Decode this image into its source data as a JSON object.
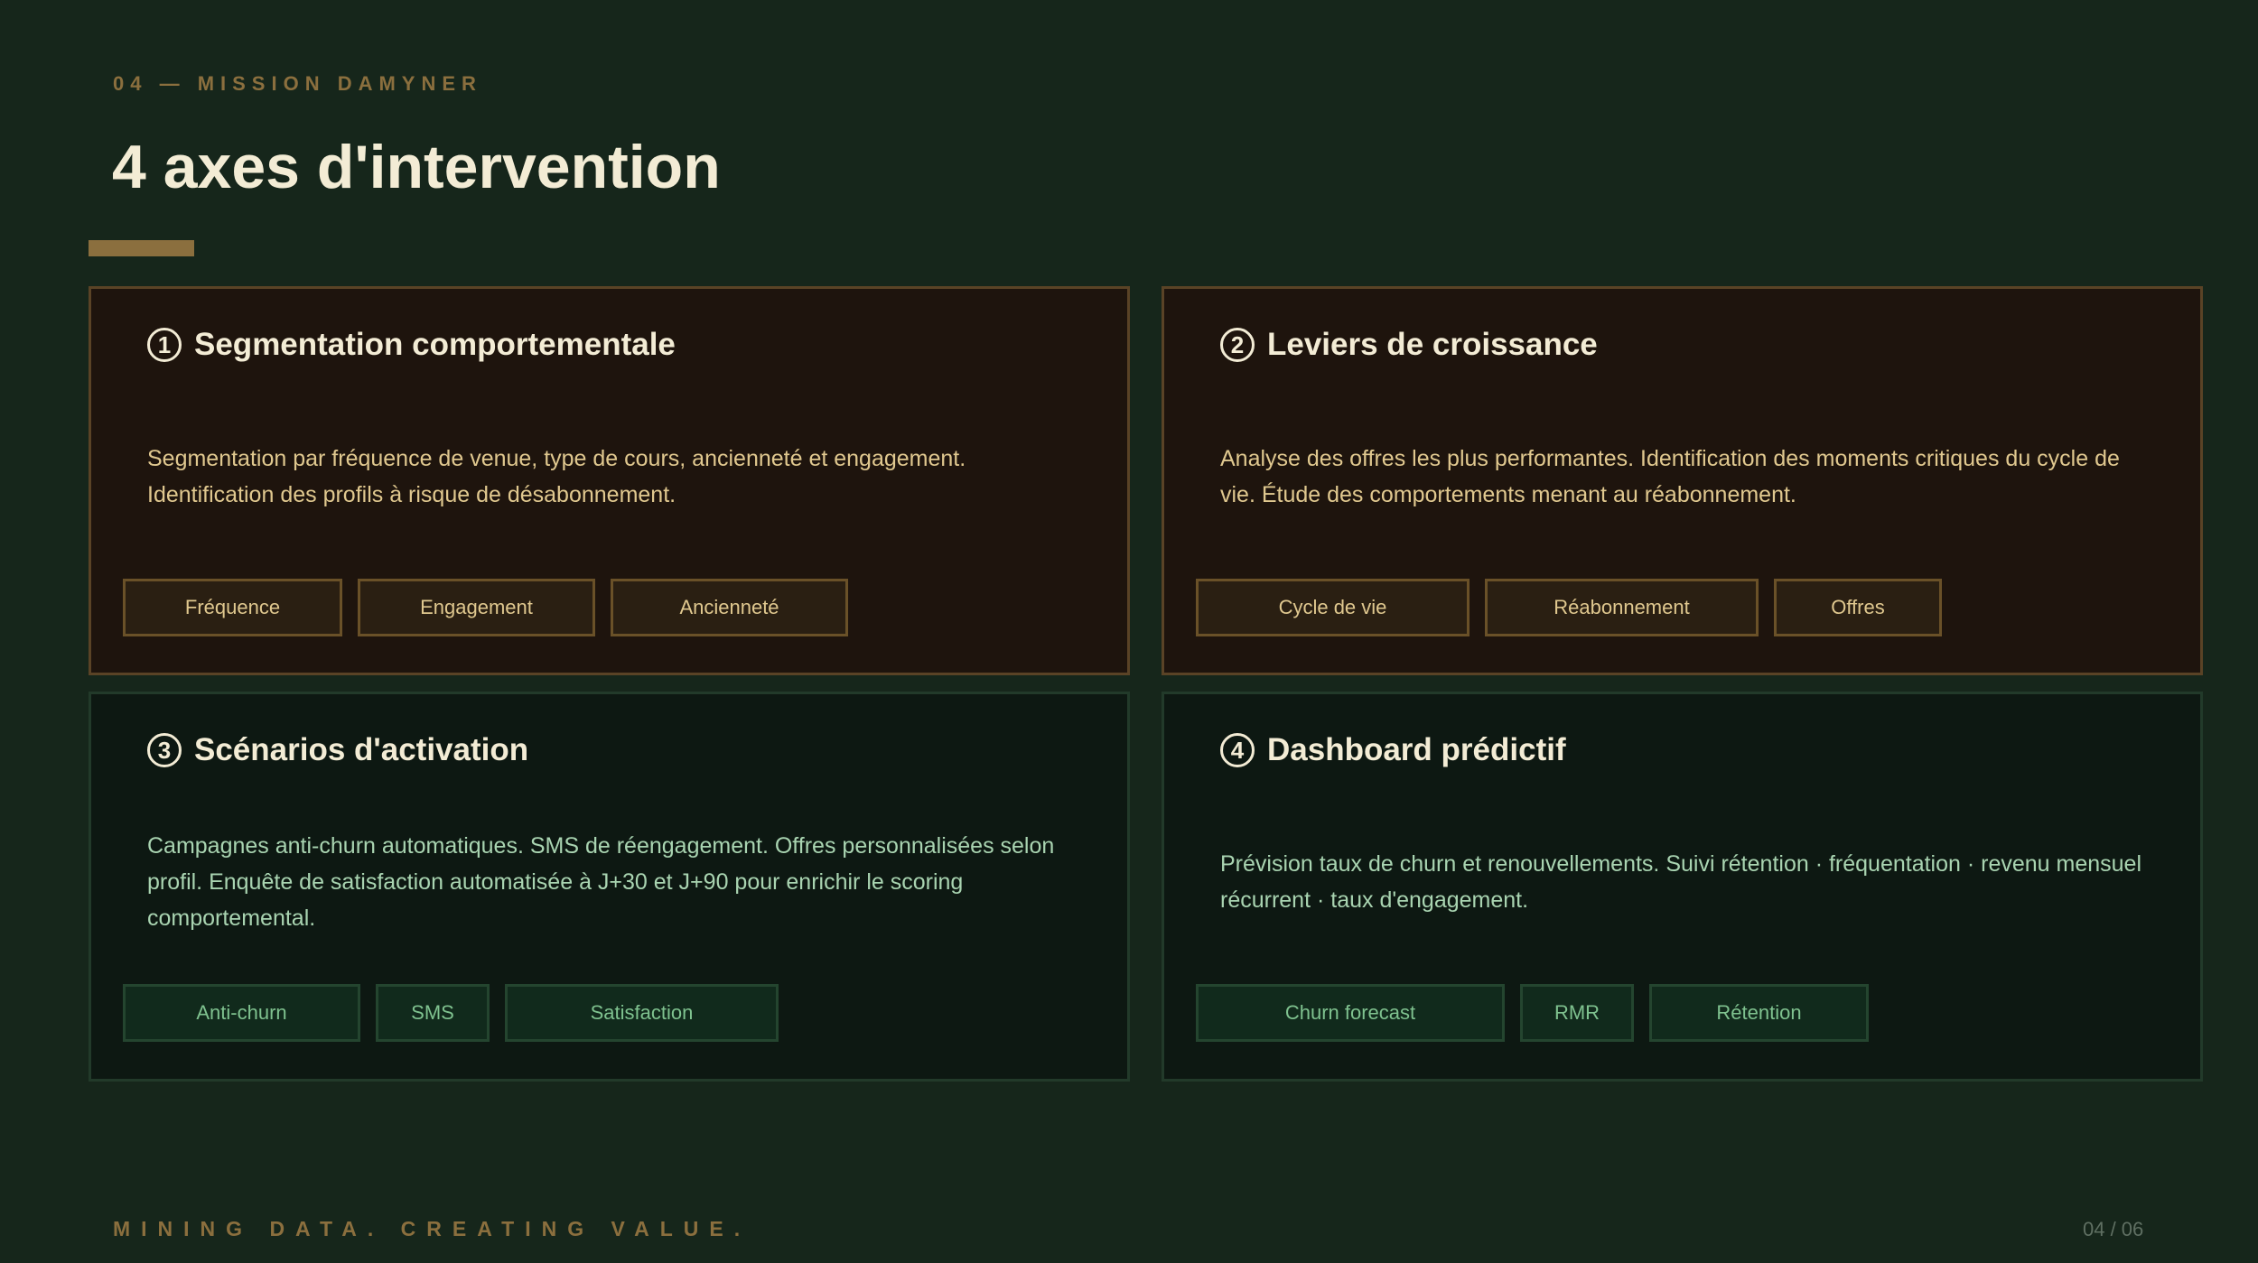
{
  "header": {
    "eyebrow": "04 — MISSION DAMYNER",
    "title": "4 axes d'intervention"
  },
  "cards": [
    {
      "number": "1",
      "title": "Segmentation comportementale",
      "description": "Segmentation par fréquence de venue, type de cours, ancienneté et engagement. Identification des profils à risque de désabonnement.",
      "tags": [
        "Fréquence",
        "Engagement",
        "Ancienneté"
      ]
    },
    {
      "number": "2",
      "title": "Leviers de croissance",
      "description": "Analyse des offres les plus performantes. Identification des moments critiques du cycle de vie. Étude des comportements menant au réabonnement.",
      "tags": [
        "Cycle de vie",
        "Réabonnement",
        "Offres"
      ]
    },
    {
      "number": "3",
      "title": "Scénarios d'activation",
      "description": "Campagnes anti-churn automatiques. SMS de réengagement. Offres personnalisées selon profil. Enquête de satisfaction automatisée à J+30 et J+90 pour enrichir le scoring comportemental.",
      "tags": [
        "Anti-churn",
        "SMS",
        "Satisfaction"
      ]
    },
    {
      "number": "4",
      "title": "Dashboard prédictif",
      "description": "Prévision taux de churn et renouvellements. Suivi rétention · fréquentation · revenu mensuel récurrent · taux d'engagement.",
      "tags": [
        "Churn forecast",
        "RMR",
        "Rétention"
      ]
    }
  ],
  "footer": {
    "tagline": "MINING DATA. CREATING VALUE.",
    "page": "04 / 06"
  }
}
